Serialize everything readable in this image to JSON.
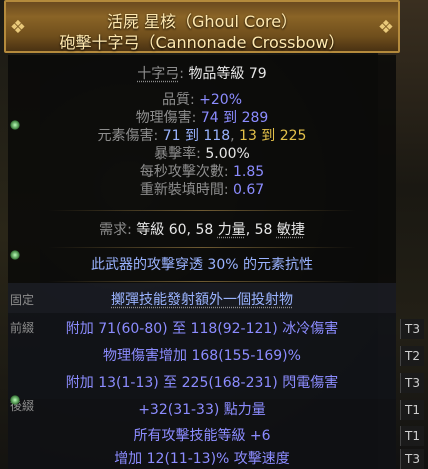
{
  "item": {
    "name": "活屍 星核（Ghoul Core）",
    "base": "砲擊十字弓（Cannonade Crossbow）"
  },
  "properties": {
    "type_label": "十字弓",
    "item_level_label": "物品等級",
    "item_level": "79",
    "quality_label": "品質:",
    "quality_value": "+20%",
    "physical_label": "物理傷害:",
    "physical_value": "74 到 289",
    "elemental_label": "元素傷害:",
    "elemental_cold": "71 到 118",
    "elemental_sep": ",",
    "elemental_lightning": "13 到 225",
    "crit_label": "暴擊率:",
    "crit_value": "5.00%",
    "aps_label": "每秒攻擊次數:",
    "aps_value": "1.85",
    "reload_label": "重新裝填時間:",
    "reload_value": "0.67"
  },
  "requirements": {
    "label": "需求:",
    "level_label": "等級",
    "level": "60",
    "str": "58",
    "str_label": "力量",
    "dex": "58",
    "dex_label": "敏捷"
  },
  "implicit": "此武器的攻擊穿透 30% 的元素抗性",
  "section_labels": {
    "fixed": "固定",
    "prefix": "前綴",
    "suffix": "後綴"
  },
  "mods": [
    {
      "text": "擲彈技能發射額外一個投射物",
      "tier": ""
    },
    {
      "text": "附加 71(60-80) 至 118(92-121) 冰冷傷害",
      "tier": "T3"
    },
    {
      "text": "物理傷害增加 168(155-169)%",
      "tier": "T2"
    },
    {
      "text": "附加 13(1-13) 至 225(168-231) 閃電傷害",
      "tier": "T3"
    },
    {
      "text": "+32(31-33) 點力量",
      "tier": "T1"
    },
    {
      "text": "所有攻擊技能等級 +6",
      "tier": "T1"
    },
    {
      "text": "增加 12(11-13)% 攻擊速度",
      "tier": "T3"
    }
  ],
  "colors": {
    "header_gold": "#b48a3c",
    "title": "#ffe9b0",
    "magic_blue": "#8c8cff",
    "lightning_gold": "#e3c04a"
  }
}
